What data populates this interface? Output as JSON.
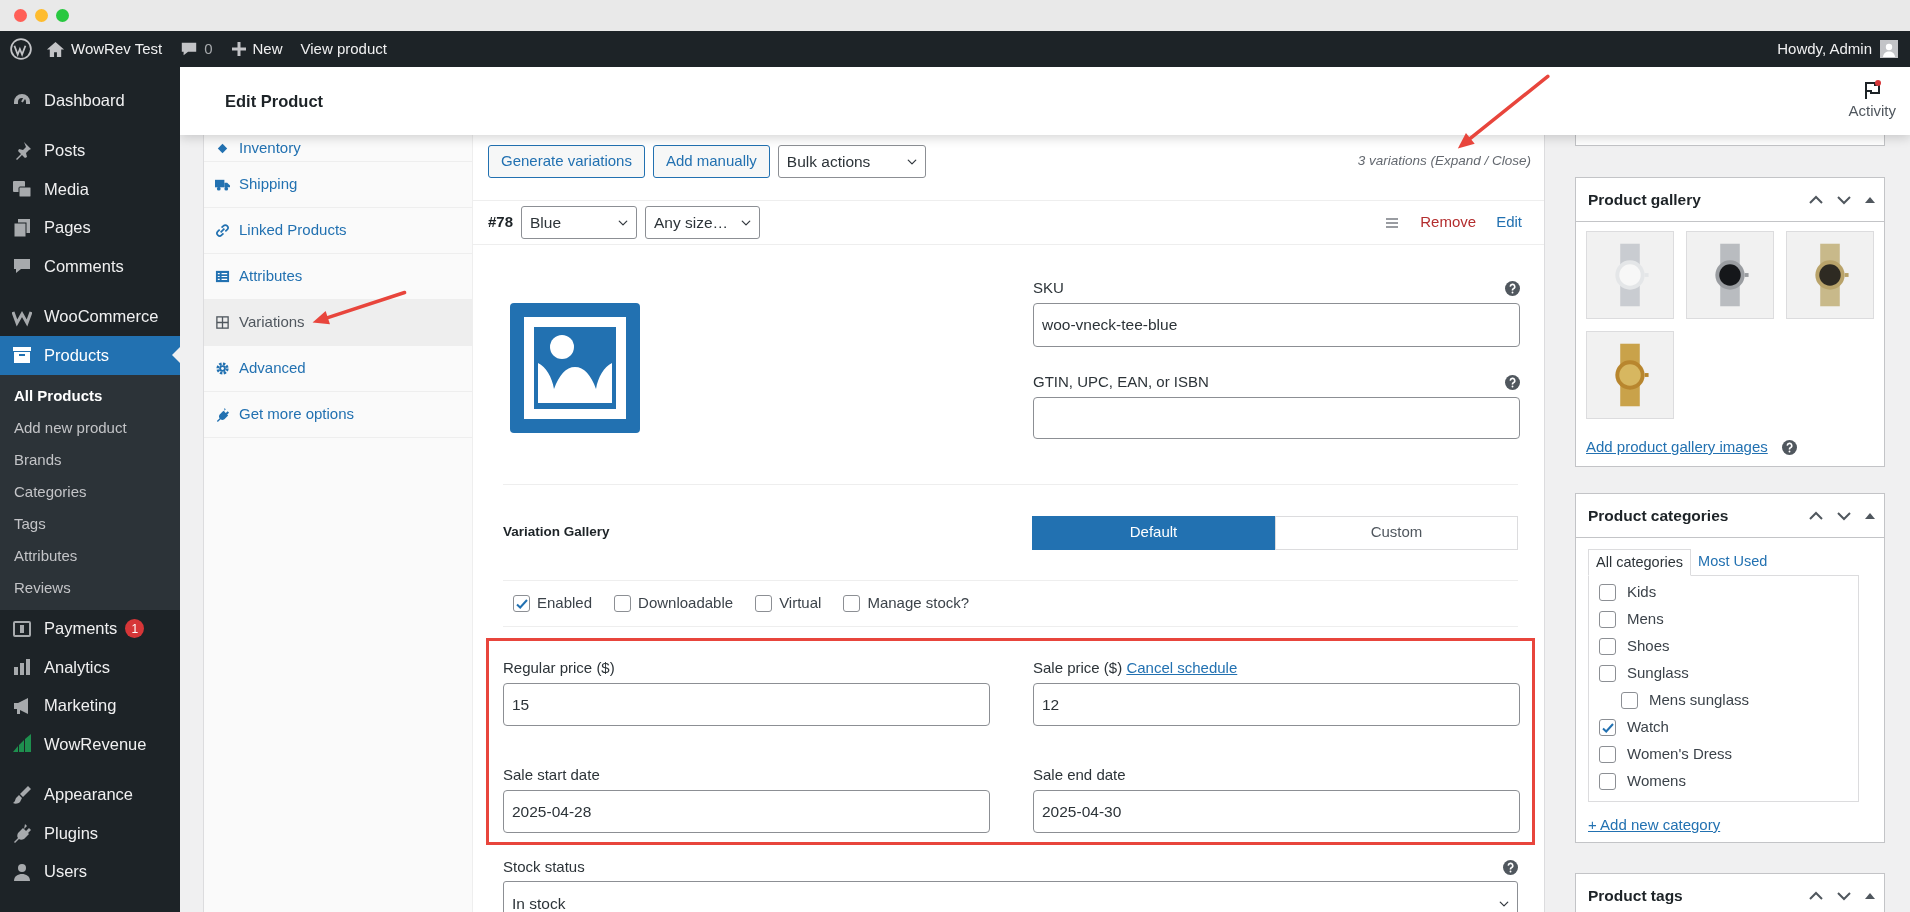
{
  "admin_bar": {
    "site": "WowRev Test",
    "comments": "0",
    "new": "New",
    "view": "View product",
    "greeting": "Howdy, Admin"
  },
  "menu": {
    "groups": [
      [
        {
          "label": "Dashboard",
          "selected": false
        }
      ],
      [
        {
          "label": "Posts",
          "selected": false
        },
        {
          "label": "Media",
          "selected": false
        },
        {
          "label": "Pages",
          "selected": false
        },
        {
          "label": "Comments",
          "selected": false
        }
      ],
      [
        {
          "label": "WooCommerce",
          "selected": false
        },
        {
          "label": "Products",
          "selected": true,
          "submenu": [
            {
              "label": "All Products",
              "selected": true
            },
            {
              "label": "Add new product",
              "selected": false
            },
            {
              "label": "Brands",
              "selected": false
            },
            {
              "label": "Categories",
              "selected": false
            },
            {
              "label": "Tags",
              "selected": false
            },
            {
              "label": "Attributes",
              "selected": false
            },
            {
              "label": "Reviews",
              "selected": false
            }
          ]
        },
        {
          "label": "Payments",
          "selected": false,
          "badge": "1"
        },
        {
          "label": "Analytics",
          "selected": false
        },
        {
          "label": "Marketing",
          "selected": false
        },
        {
          "label": "WowRevenue",
          "selected": false
        }
      ],
      [
        {
          "label": "Appearance",
          "selected": false
        },
        {
          "label": "Plugins",
          "selected": false
        },
        {
          "label": "Users",
          "selected": false
        }
      ]
    ]
  },
  "header": {
    "title": "Edit Product",
    "activity": "Activity",
    "activity_unread": true
  },
  "product_tabs": [
    {
      "label": "Inventory",
      "selected": false,
      "annotated": false
    },
    {
      "label": "Shipping",
      "selected": false,
      "annotated": false
    },
    {
      "label": "Linked Products",
      "selected": false,
      "annotated": false
    },
    {
      "label": "Attributes",
      "selected": false,
      "annotated": false
    },
    {
      "label": "Variations",
      "selected": true,
      "annotated": true
    },
    {
      "label": "Advanced",
      "selected": false,
      "annotated": false
    },
    {
      "label": "Get more options",
      "selected": false,
      "annotated": false
    }
  ],
  "variations": {
    "buttons": [
      "Generate variations",
      "Add manually"
    ],
    "bulk_select": "Bulk actions",
    "summary": {
      "text": "3 variations (",
      "expand": "Expand",
      "separator": " / ",
      "close": "Close",
      "end": ")",
      "annotated": true
    }
  },
  "variation": {
    "number": "#78",
    "attributes": [
      "Blue",
      "Any size…"
    ],
    "remove": "Remove",
    "edit": "Edit",
    "sku": {
      "label": "SKU",
      "value": "woo-vneck-tee-blue"
    },
    "gtin": {
      "label": "GTIN, UPC, EAN, or ISBN"
    },
    "gallery": {
      "label": "Variation Gallery",
      "options": [
        {
          "label": "Default",
          "selected": true
        },
        {
          "label": "Custom",
          "selected": false
        }
      ]
    },
    "options": [
      {
        "label": "Enabled",
        "checked": true
      },
      {
        "label": "Downloadable",
        "checked": false
      },
      {
        "label": "Virtual",
        "checked": false
      },
      {
        "label": "Manage stock?",
        "checked": false
      }
    ],
    "pricing": {
      "annotated": true,
      "fields": [
        {
          "label": "Regular price ($)",
          "value": "15"
        },
        {
          "label": "Sale price ($)",
          "link": "Cancel schedule",
          "value": "12"
        },
        {
          "label": "Sale start date",
          "value": "2025-04-28"
        },
        {
          "label": "Sale end date",
          "value": "2025-04-30"
        }
      ]
    },
    "stock_status": {
      "label": "Stock status",
      "value": "In stock"
    }
  },
  "gallery_box": {
    "title": "Product gallery",
    "link": "Add product gallery images"
  },
  "categories_box": {
    "title": "Product categories",
    "tabs": [
      {
        "label": "All categories",
        "selected": true
      },
      {
        "label": "Most Used",
        "selected": false
      }
    ],
    "items": [
      {
        "label": "Kids",
        "checked": false
      },
      {
        "label": "Mens",
        "checked": false
      },
      {
        "label": "Shoes",
        "checked": false
      },
      {
        "label": "Sunglass",
        "checked": false,
        "children": [
          {
            "label": "Mens sunglass",
            "checked": false
          }
        ]
      },
      {
        "label": "Watch",
        "checked": true
      },
      {
        "label": "Women's Dress",
        "checked": false
      },
      {
        "label": "Womens",
        "checked": false
      }
    ],
    "add_link": "+ Add new category"
  },
  "tags_box": {
    "title": "Product tags"
  }
}
